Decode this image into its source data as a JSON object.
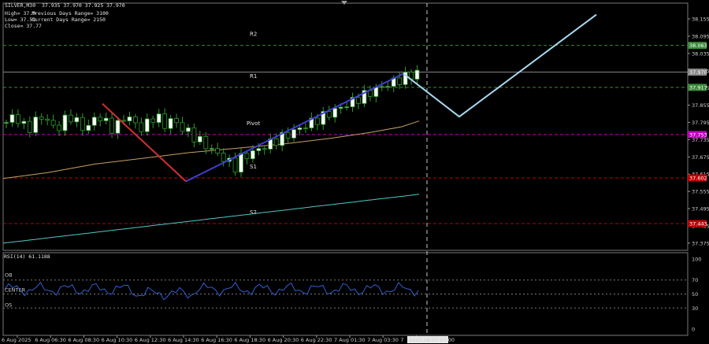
{
  "header": {
    "symbol_line": "SILVER,M30  37.935 37.970 37.925 37.970",
    "high": "High= 37.9",
    "prev_range": "Previous Days Range= 3100",
    "low": "Low= 37.59",
    "curr_range": "Current Days Range= 2150",
    "close": "Close= 37.77"
  },
  "levels": {
    "r2": "R2",
    "r1": "R1",
    "pivot": "Pivot",
    "s1": "S1",
    "s2": "S2"
  },
  "price_axis": {
    "ticks": [
      "38.155",
      "38.095",
      "38.035",
      "37.975",
      "37.915",
      "37.855",
      "37.795",
      "37.735",
      "37.675",
      "37.615",
      "37.555",
      "37.495",
      "37.435",
      "37.375"
    ],
    "tags": [
      {
        "text": "38.063",
        "color": "#3a8a3a"
      },
      {
        "text": "37.970",
        "color": "#8a8a8a"
      },
      {
        "text": "37.917",
        "color": "#3a8a3a"
      },
      {
        "text": "37.753",
        "color": "#c000c0"
      },
      {
        "text": "37.602",
        "color": "#c00000"
      },
      {
        "text": "37.443",
        "color": "#c00000"
      }
    ]
  },
  "rsi": {
    "title": "RSI(14) 61.1188",
    "ob": "OB",
    "center": "CENTER",
    "os": "OS",
    "ticks": [
      "100",
      "70",
      "50",
      "30",
      "0"
    ]
  },
  "time_axis": {
    "labels": [
      "6 Aug 2025",
      "6 Aug 06:30",
      "6 Aug 08:30",
      "6 Aug 10:30",
      "6 Aug 12:30",
      "6 Aug 14:30",
      "6 Aug 16:30",
      "6 Aug 18:30",
      "6 Aug 20:30",
      "6 Aug 22:30",
      "7 Aug 01:30",
      "7 Aug 03:30",
      "7"
    ],
    "cursor_label": "2025.08.07 07:00"
  },
  "colors": {
    "bull": "#ffffff",
    "bear": "#000000",
    "wick": "#2e9b2e",
    "trend_down": "#d03030",
    "trend_up": "#4040d0",
    "projection": "#a8d8f0",
    "ma_fast": "#c8a060",
    "ma_slow": "#50c8c8",
    "rsi_line": "#3060d0"
  },
  "chart_data": {
    "type": "candlestick",
    "symbol": "SILVER",
    "timeframe": "M30",
    "ylim": [
      37.35,
      38.21
    ],
    "pivot_levels": {
      "R2": 38.063,
      "R1": 37.917,
      "Pivot": 37.753,
      "S1": 37.602,
      "S2": 37.443
    },
    "last_price": 37.97,
    "rsi": {
      "period": 14,
      "value": 61.1188,
      "levels": [
        70,
        50,
        30
      ]
    }
  }
}
